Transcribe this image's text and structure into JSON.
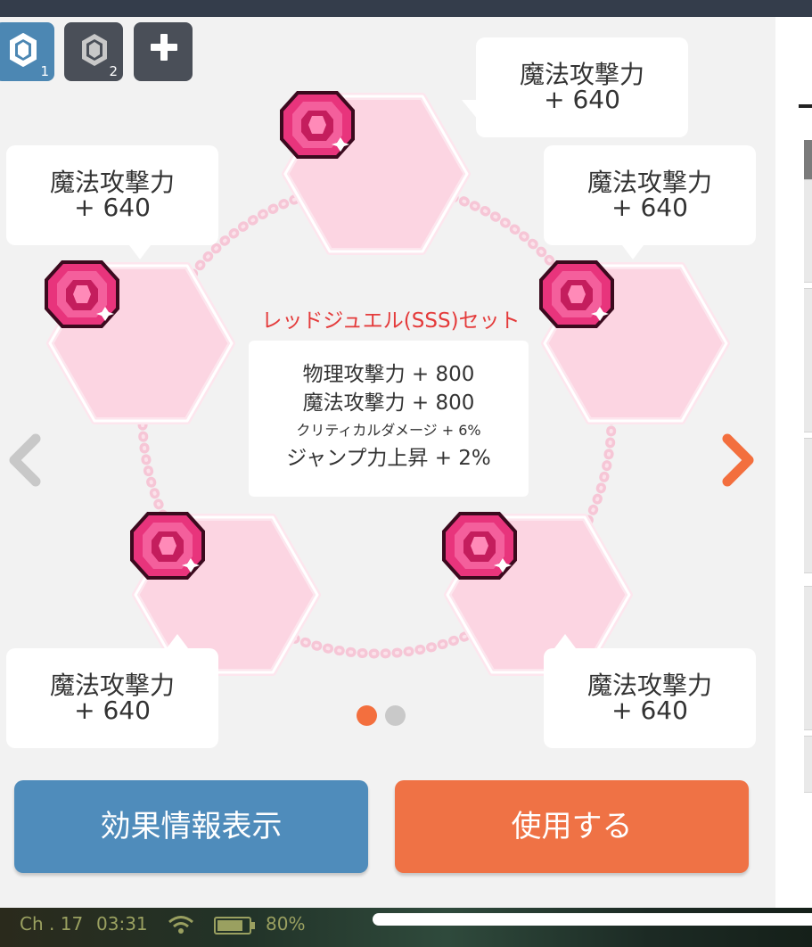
{
  "tabs": [
    {
      "label": "1",
      "icon": "jewel-icon",
      "active": true
    },
    {
      "label": "2",
      "icon": "jewel-icon",
      "active": false
    },
    {
      "label": "",
      "icon": "plus-icon",
      "active": false
    }
  ],
  "slots": [
    {
      "name": "top",
      "stat": "魔法攻撃力",
      "value": "+ 640"
    },
    {
      "name": "upper-left",
      "stat": "魔法攻撃力",
      "value": "+ 640"
    },
    {
      "name": "upper-right",
      "stat": "魔法攻撃力",
      "value": "+ 640"
    },
    {
      "name": "lower-left",
      "stat": "魔法攻撃力",
      "value": "+ 640"
    },
    {
      "name": "lower-right",
      "stat": "魔法攻撃力",
      "value": "+ 640"
    }
  ],
  "set_bonus": {
    "title": "レッドジュエル(SSS)セット",
    "effects": [
      "物理攻撃力 + 800",
      "魔法攻撃力 + 800",
      "クリティカルダメージ + 6%",
      "ジャンプ力上昇 + 2%"
    ]
  },
  "pagination": {
    "current": 1,
    "total": 2
  },
  "buttons": {
    "info": "効果情報表示",
    "use": "使用する"
  },
  "status_bar": {
    "channel": "Ch . 17",
    "time": "03:31",
    "battery": "80%"
  },
  "colors": {
    "accent_orange": "#ef7245",
    "accent_blue": "#4f8cbb",
    "set_title_red": "#e43b3b",
    "hex_pink": "#fdd6e3"
  }
}
